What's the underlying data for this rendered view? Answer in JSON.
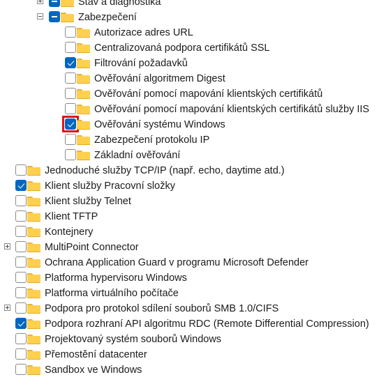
{
  "tree": {
    "items": [
      {
        "label": "Stav a diagnostika",
        "state": "partial",
        "expander": "plus",
        "level": 2
      },
      {
        "label": "Zabezpečení",
        "state": "partial",
        "expander": "minus",
        "level": 2
      },
      {
        "label": "Autorizace adres URL",
        "state": "unchecked",
        "expander": "",
        "level": 3
      },
      {
        "label": "Centralizovaná podpora certifikátů SSL",
        "state": "unchecked",
        "expander": "",
        "level": 3
      },
      {
        "label": "Filtrování požadavků",
        "state": "checked",
        "expander": "",
        "level": 3
      },
      {
        "label": "Ověřování algoritmem Digest",
        "state": "unchecked",
        "expander": "",
        "level": 3
      },
      {
        "label": "Ověřování pomocí mapování klientských certifikátů",
        "state": "unchecked",
        "expander": "",
        "level": 3
      },
      {
        "label": "Ověřování pomocí mapování klientských certifikátů služby IIS",
        "state": "unchecked",
        "expander": "",
        "level": 3
      },
      {
        "label": "Ověřování systému Windows",
        "state": "checked",
        "expander": "",
        "level": 3,
        "highlighted": true
      },
      {
        "label": "Zabezpečení protokolu IP",
        "state": "unchecked",
        "expander": "",
        "level": 3
      },
      {
        "label": "Základní ověřování",
        "state": "unchecked",
        "expander": "",
        "level": 3
      },
      {
        "label": "Jednoduché služby TCP/IP (např. echo, daytime atd.)",
        "state": "unchecked",
        "expander": "",
        "level": 0
      },
      {
        "label": "Klient služby Pracovní složky",
        "state": "checked",
        "expander": "",
        "level": 0
      },
      {
        "label": "Klient služby Telnet",
        "state": "unchecked",
        "expander": "",
        "level": 0
      },
      {
        "label": "Klient TFTP",
        "state": "unchecked",
        "expander": "",
        "level": 0
      },
      {
        "label": "Kontejnery",
        "state": "unchecked",
        "expander": "",
        "level": 0
      },
      {
        "label": "MultiPoint Connector",
        "state": "unchecked",
        "expander": "plus",
        "level": 0
      },
      {
        "label": "Ochrana Application Guard v programu Microsoft Defender",
        "state": "unchecked",
        "expander": "",
        "level": 0
      },
      {
        "label": "Platforma hypervisoru Windows",
        "state": "unchecked",
        "expander": "",
        "level": 0
      },
      {
        "label": "Platforma virtuálního počítače",
        "state": "unchecked",
        "expander": "",
        "level": 0
      },
      {
        "label": "Podpora pro protokol sdílení souborů SMB 1.0/CIFS",
        "state": "unchecked",
        "expander": "plus",
        "level": 0
      },
      {
        "label": "Podpora rozhraní API algoritmu RDC (Remote Differential Compression)",
        "state": "checked",
        "expander": "",
        "level": 0
      },
      {
        "label": "Projektovaný systém souborů Windows",
        "state": "unchecked",
        "expander": "",
        "level": 0
      },
      {
        "label": "Přemostění datacenter",
        "state": "unchecked",
        "expander": "",
        "level": 0
      },
      {
        "label": "Sandbox ve Windows",
        "state": "unchecked",
        "expander": "",
        "level": 0
      }
    ]
  },
  "colors": {
    "checkbox_accent": "#0067c0",
    "highlight_box": "#e0141a",
    "folder": "#ffd04d"
  },
  "icons": {
    "folder": "folder-icon",
    "expander_plus": "expand-plus-icon",
    "expander_minus": "collapse-minus-icon"
  }
}
